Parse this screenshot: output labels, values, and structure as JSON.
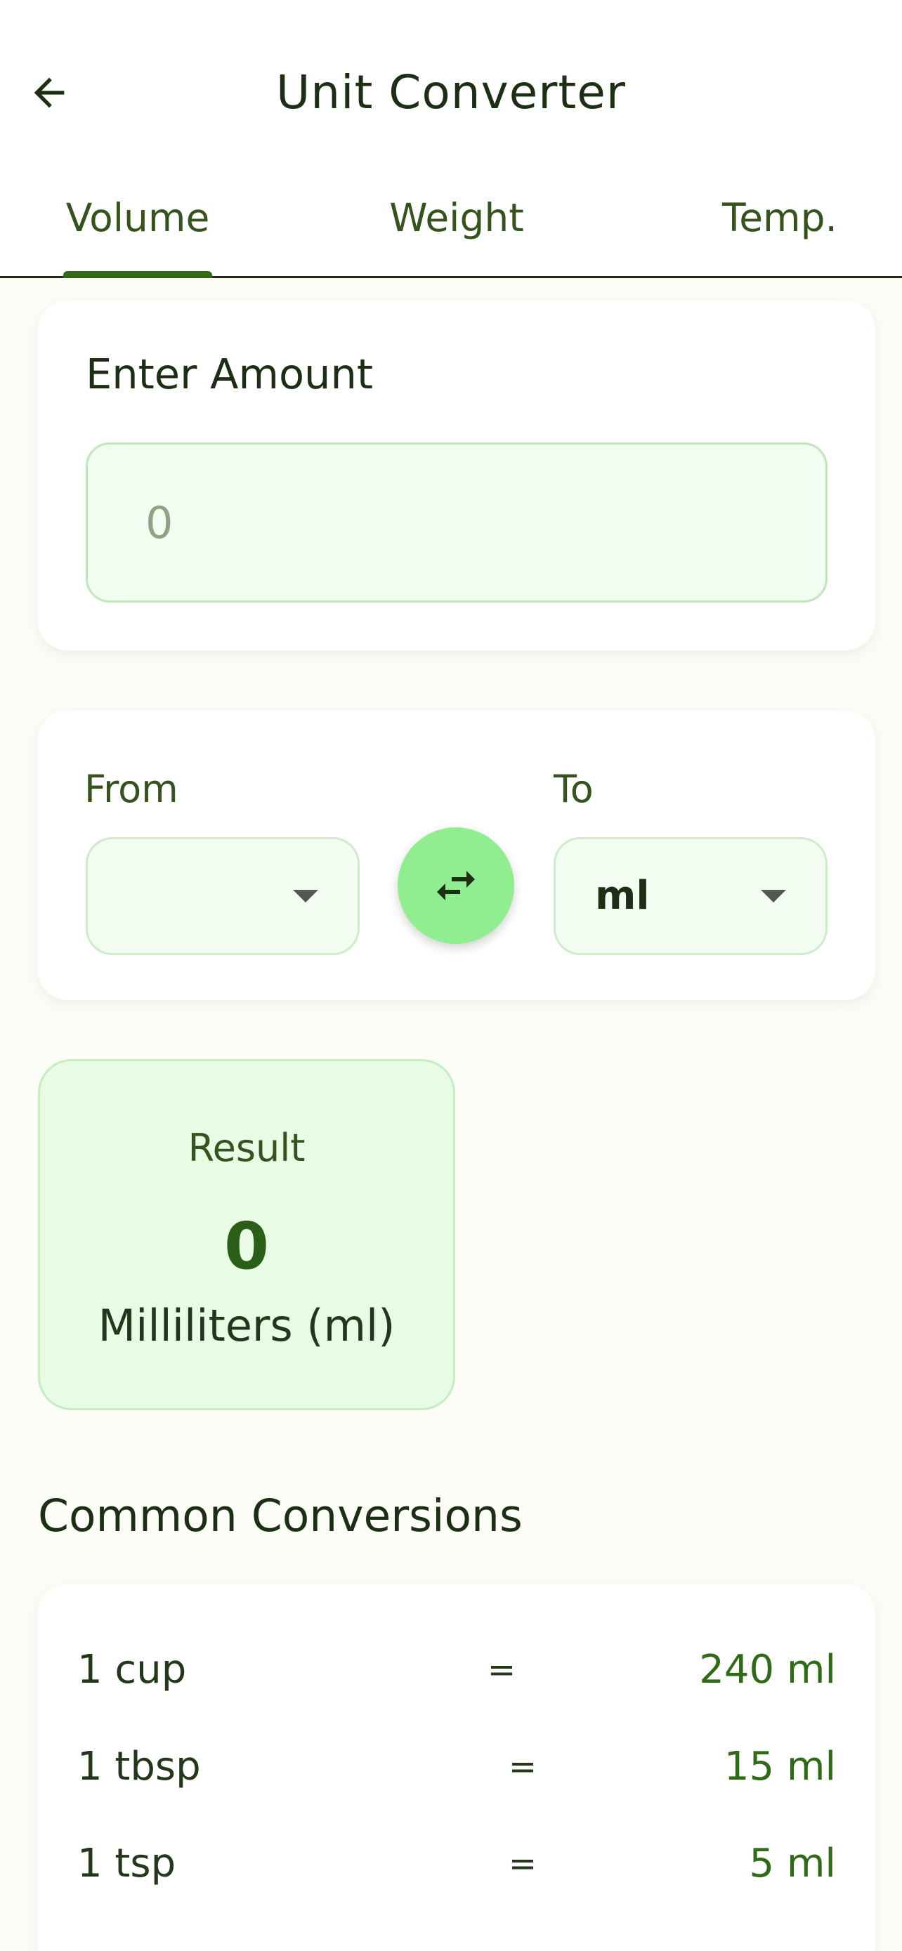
{
  "header": {
    "title": "Unit Converter",
    "back_icon": "arrow-left-icon"
  },
  "tabs": [
    {
      "label": "Volume",
      "selected": true
    },
    {
      "label": "Weight",
      "selected": false
    },
    {
      "label": "Temp.",
      "selected": false
    }
  ],
  "amount": {
    "label": "Enter Amount",
    "placeholder": "0",
    "value": ""
  },
  "units": {
    "from_label": "From",
    "from_value": "",
    "to_label": "To",
    "to_value": "ml",
    "swap_icon": "swap-horizontal-icon"
  },
  "result": {
    "label": "Result",
    "value": "0",
    "unit": "Milliliters (ml)"
  },
  "common": {
    "title": "Common Conversions",
    "rows": [
      {
        "left": "1 cup",
        "eq": "=",
        "right": "240 ml"
      },
      {
        "left": "1 tbsp",
        "eq": "=",
        "right": "15 ml"
      },
      {
        "left": "1 tsp",
        "eq": "=",
        "right": "5 ml"
      }
    ]
  },
  "colors": {
    "accent": "#2f6b17",
    "swap_button": "#90ee90",
    "result_bg": "#e8fce5",
    "background": "#fcfdf7"
  }
}
